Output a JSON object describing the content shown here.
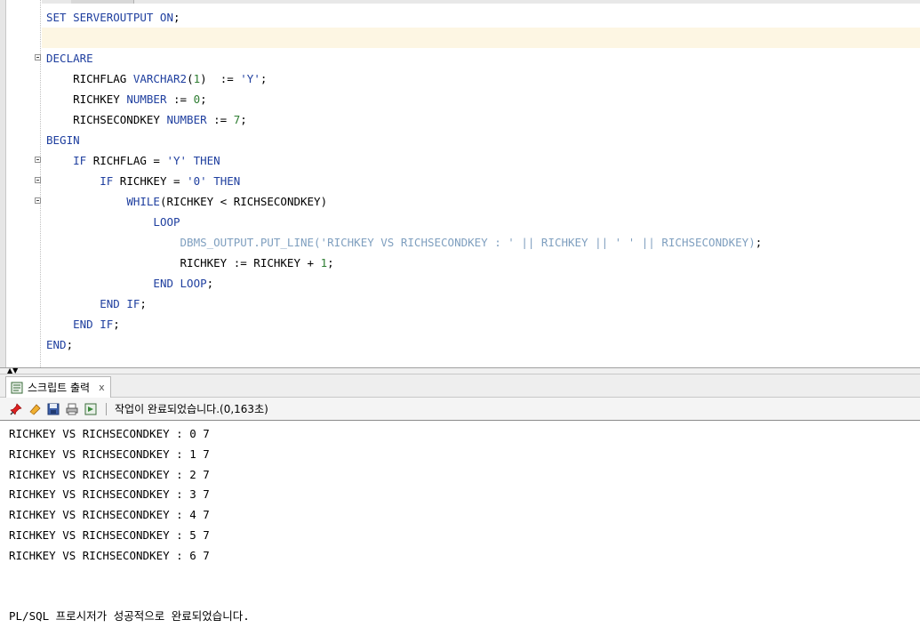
{
  "editor": {
    "lines": [
      {
        "segments": [
          {
            "t": "SET SERVEROUTPUT ON",
            "c": "kw"
          },
          {
            "t": ";",
            "c": ""
          }
        ]
      },
      {
        "segments": []
      },
      {
        "segments": [
          {
            "t": "DECLARE",
            "c": "kw"
          }
        ]
      },
      {
        "segments": [
          {
            "t": "    RICHFLAG ",
            "c": ""
          },
          {
            "t": "VARCHAR2",
            "c": "kw"
          },
          {
            "t": "(",
            "c": ""
          },
          {
            "t": "1",
            "c": "num"
          },
          {
            "t": ")  := ",
            "c": ""
          },
          {
            "t": "'Y'",
            "c": "str"
          },
          {
            "t": ";",
            "c": ""
          }
        ]
      },
      {
        "segments": [
          {
            "t": "    RICHKEY ",
            "c": ""
          },
          {
            "t": "NUMBER",
            "c": "kw"
          },
          {
            "t": " := ",
            "c": ""
          },
          {
            "t": "0",
            "c": "num"
          },
          {
            "t": ";",
            "c": ""
          }
        ]
      },
      {
        "segments": [
          {
            "t": "    RICHSECONDKEY ",
            "c": ""
          },
          {
            "t": "NUMBER",
            "c": "kw"
          },
          {
            "t": " := ",
            "c": ""
          },
          {
            "t": "7",
            "c": "num"
          },
          {
            "t": ";",
            "c": ""
          }
        ]
      },
      {
        "segments": [
          {
            "t": "BEGIN",
            "c": "kw"
          }
        ]
      },
      {
        "segments": [
          {
            "t": "    ",
            "c": ""
          },
          {
            "t": "IF",
            "c": "kw"
          },
          {
            "t": " RICHFLAG = ",
            "c": ""
          },
          {
            "t": "'Y'",
            "c": "str"
          },
          {
            "t": " ",
            "c": ""
          },
          {
            "t": "THEN",
            "c": "kw"
          }
        ]
      },
      {
        "segments": [
          {
            "t": "        ",
            "c": ""
          },
          {
            "t": "IF",
            "c": "kw"
          },
          {
            "t": " RICHKEY = ",
            "c": ""
          },
          {
            "t": "'0'",
            "c": "str"
          },
          {
            "t": " ",
            "c": ""
          },
          {
            "t": "THEN",
            "c": "kw"
          }
        ]
      },
      {
        "segments": [
          {
            "t": "            ",
            "c": ""
          },
          {
            "t": "WHILE",
            "c": "kw"
          },
          {
            "t": "(RICHKEY < RICHSECONDKEY)",
            "c": ""
          }
        ]
      },
      {
        "segments": [
          {
            "t": "                ",
            "c": ""
          },
          {
            "t": "LOOP",
            "c": "kw"
          }
        ]
      },
      {
        "segments": [
          {
            "t": "                    ",
            "c": ""
          },
          {
            "t": "DBMS_OUTPUT.PUT_LINE('RICHKEY VS RICHSECONDKEY : ' || RICHKEY || ' ' || RICHSECONDKEY)",
            "c": "fn"
          },
          {
            "t": ";",
            "c": ""
          }
        ]
      },
      {
        "segments": [
          {
            "t": "                    RICHKEY := RICHKEY + ",
            "c": ""
          },
          {
            "t": "1",
            "c": "num"
          },
          {
            "t": ";",
            "c": ""
          }
        ]
      },
      {
        "segments": [
          {
            "t": "                ",
            "c": ""
          },
          {
            "t": "END LOOP",
            "c": "kw"
          },
          {
            "t": ";",
            "c": ""
          }
        ]
      },
      {
        "segments": [
          {
            "t": "        ",
            "c": ""
          },
          {
            "t": "END IF",
            "c": "kw"
          },
          {
            "t": ";",
            "c": ""
          }
        ]
      },
      {
        "segments": [
          {
            "t": "    ",
            "c": ""
          },
          {
            "t": "END IF",
            "c": "kw"
          },
          {
            "t": ";",
            "c": ""
          }
        ]
      },
      {
        "segments": [
          {
            "t": "END",
            "c": "kw"
          },
          {
            "t": ";",
            "c": ""
          }
        ]
      }
    ]
  },
  "output_panel": {
    "tab_label": "스크립트 출력",
    "tab_close": "x",
    "status": "작업이 완료되었습니다.(0,163초)",
    "lines": [
      "RICHKEY VS RICHSECONDKEY : 0 7",
      "RICHKEY VS RICHSECONDKEY : 1 7",
      "RICHKEY VS RICHSECONDKEY : 2 7",
      "RICHKEY VS RICHSECONDKEY : 3 7",
      "RICHKEY VS RICHSECONDKEY : 4 7",
      "RICHKEY VS RICHSECONDKEY : 5 7",
      "RICHKEY VS RICHSECONDKEY : 6 7"
    ],
    "completion": "PL/SQL 프로시저가 성공적으로 완료되었습니다."
  }
}
